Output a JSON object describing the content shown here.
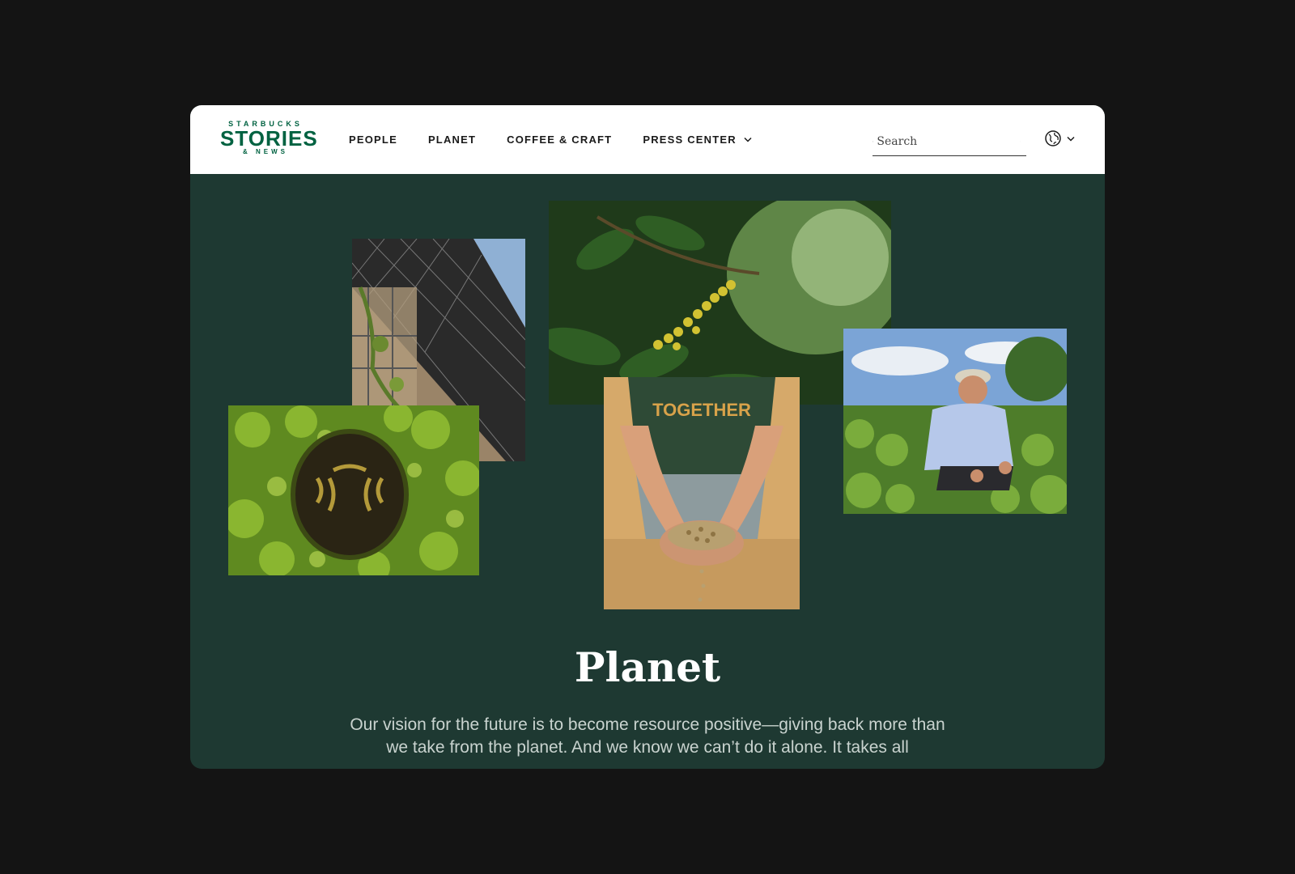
{
  "logo": {
    "brand": "STARBUCKS",
    "main": "STORIES",
    "sub": "& NEWS"
  },
  "nav": {
    "items": [
      {
        "label": "PEOPLE"
      },
      {
        "label": "PLANET"
      },
      {
        "label": "COFFEE & CRAFT"
      },
      {
        "label": "PRESS CENTER",
        "has_dropdown": true
      }
    ]
  },
  "search": {
    "placeholder": "Search"
  },
  "globe": {
    "icon": "globe-icon"
  },
  "hero": {
    "title": "Planet",
    "description": "Our vision for the future is to become resource positive—giving back more than we take from the planet. And we know we can’t do it alone. It takes all"
  },
  "photos": [
    {
      "name": "photo-solar-building",
      "subject": "solar panels on building"
    },
    {
      "name": "photo-coffee-cherries",
      "subject": "coffee cherries on branch"
    },
    {
      "name": "photo-siren-planter",
      "subject": "Starbucks siren logo in greenery"
    },
    {
      "name": "photo-hands-coffee-beans",
      "subject": "hands holding coffee beans"
    },
    {
      "name": "photo-farmer-field",
      "subject": "farmer kneeling in coffee field"
    }
  ],
  "colors": {
    "brand_green": "#006241",
    "hero_bg": "#1e3932",
    "page_bg": "#141414"
  }
}
